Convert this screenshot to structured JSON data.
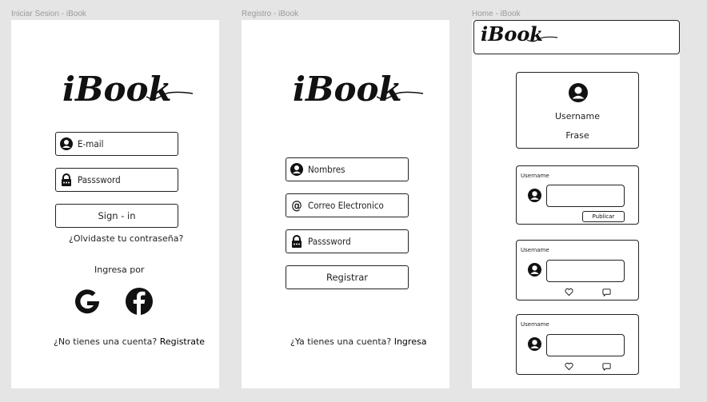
{
  "frames": {
    "login_label": "Iniciar Sesion - iBook",
    "register_label": "Registro - iBook",
    "home_label": "Home - iBook"
  },
  "brand": {
    "logo_text": "iBook"
  },
  "login": {
    "email_placeholder": "E-mail",
    "password_placeholder": "Passsword",
    "signin_label": "Sign - in",
    "forgot_link": "¿Olvidaste tu contraseña?",
    "social_prompt": "Ingresa por",
    "no_account_text": "¿No tienes una cuenta?",
    "register_link": "Registrate",
    "social_icons": [
      "google-icon",
      "facebook-icon"
    ]
  },
  "register": {
    "name_placeholder": "Nombres",
    "email_placeholder": "Correo Electronico",
    "password_placeholder": "Passsword",
    "register_button": "Registrar",
    "have_account_text": "¿Ya tienes una cuenta?",
    "login_link": "Ingresa"
  },
  "home": {
    "profile": {
      "username": "Username",
      "phrase": "Frase"
    },
    "composer": {
      "username": "Username",
      "publish_label": "Publicar"
    },
    "posts": [
      {
        "username": "Username"
      },
      {
        "username": "Username"
      }
    ]
  }
}
